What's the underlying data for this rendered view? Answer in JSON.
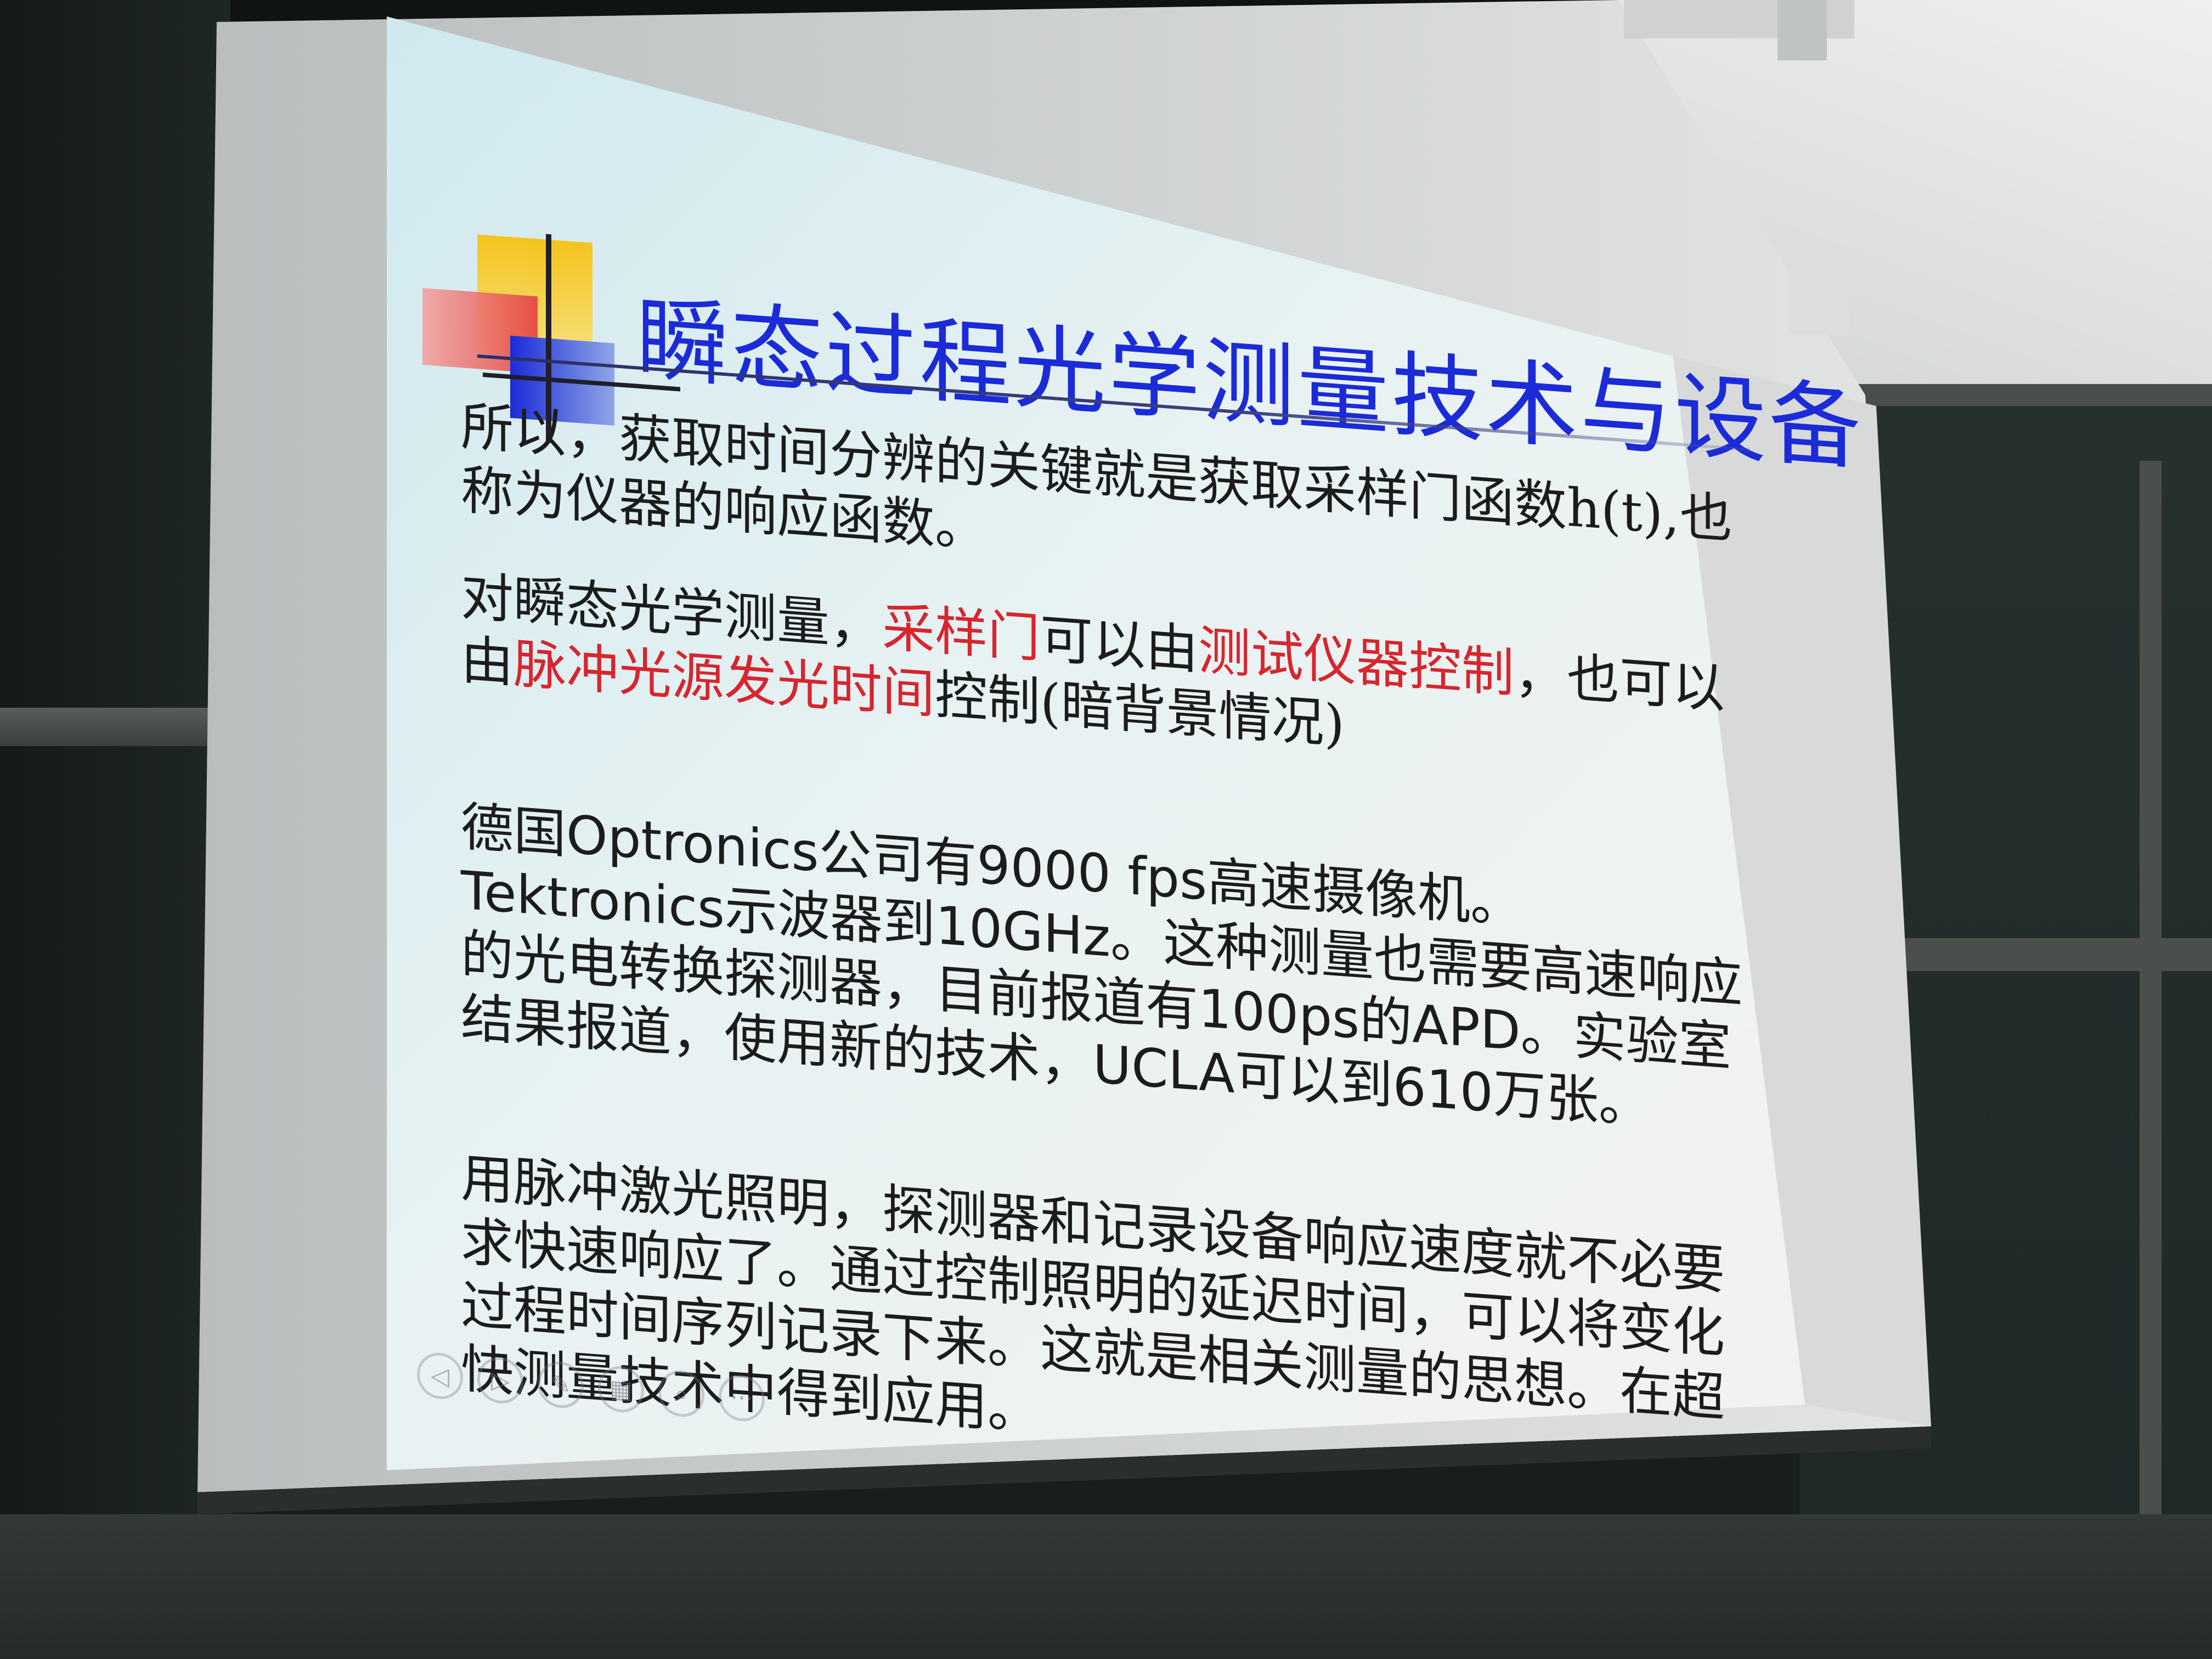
{
  "slide": {
    "title": "瞬态过程光学测量技术与设备",
    "p1": "所以，获取时间分辨的关键就是获取采样门函数h(t),也称为仪器的响应函数。",
    "p2_a": "对瞬态光学测量，",
    "p2_b": "采样门",
    "p2_c": "可以由",
    "p2_d": "测试仪器控制",
    "p2_e": "，也可以由",
    "p2_f": "脉冲光源发光时间",
    "p2_g": "控制(暗背景情况)",
    "p3": "德国Optronics公司有9000 fps高速摄像机。Tektronics示波器到10GHz。这种测量也需要高速响应的光电转换探测器，目前报道有100ps的APD。实验室结果报道，使用新的技术，UCLA可以到610万张。",
    "p4": "用脉冲激光照明，探测器和记录设备响应速度就不必要求快速响应了。通过控制照明的延迟时间，可以将变化过程时间序列记录下来。这就是相关测量的思想。在超快测量技术中得到应用。"
  },
  "nav": {
    "prev_icon": "◁",
    "next_icon": "▷",
    "pen_icon": "✎",
    "slides_icon": "▦",
    "zoom_icon": "⌕",
    "more_icon": "···"
  },
  "colors": {
    "title": "#1b2bd8",
    "highlight": "#d6262e",
    "text": "#1c1c1c",
    "logo_yellow": "#f2c521",
    "logo_red": "#e4413f",
    "logo_blue": "#1b2bd8"
  }
}
